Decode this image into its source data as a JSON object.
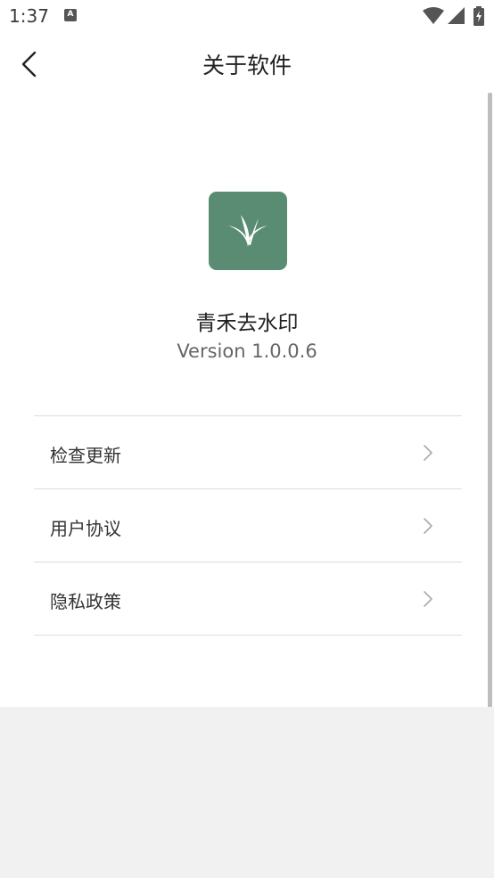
{
  "status_bar": {
    "time": "1:37",
    "notification_icon": "A"
  },
  "header": {
    "title": "关于软件"
  },
  "app": {
    "name": "青禾去水印",
    "version": "Version 1.0.0.6",
    "logo_color": "#5a8b73"
  },
  "menu": {
    "items": [
      {
        "label": "检查更新"
      },
      {
        "label": "用户协议"
      },
      {
        "label": "隐私政策"
      }
    ]
  },
  "colors": {
    "background": "#ffffff",
    "bottom_area": "#f1f1f1",
    "divider": "#dcdcdc"
  }
}
